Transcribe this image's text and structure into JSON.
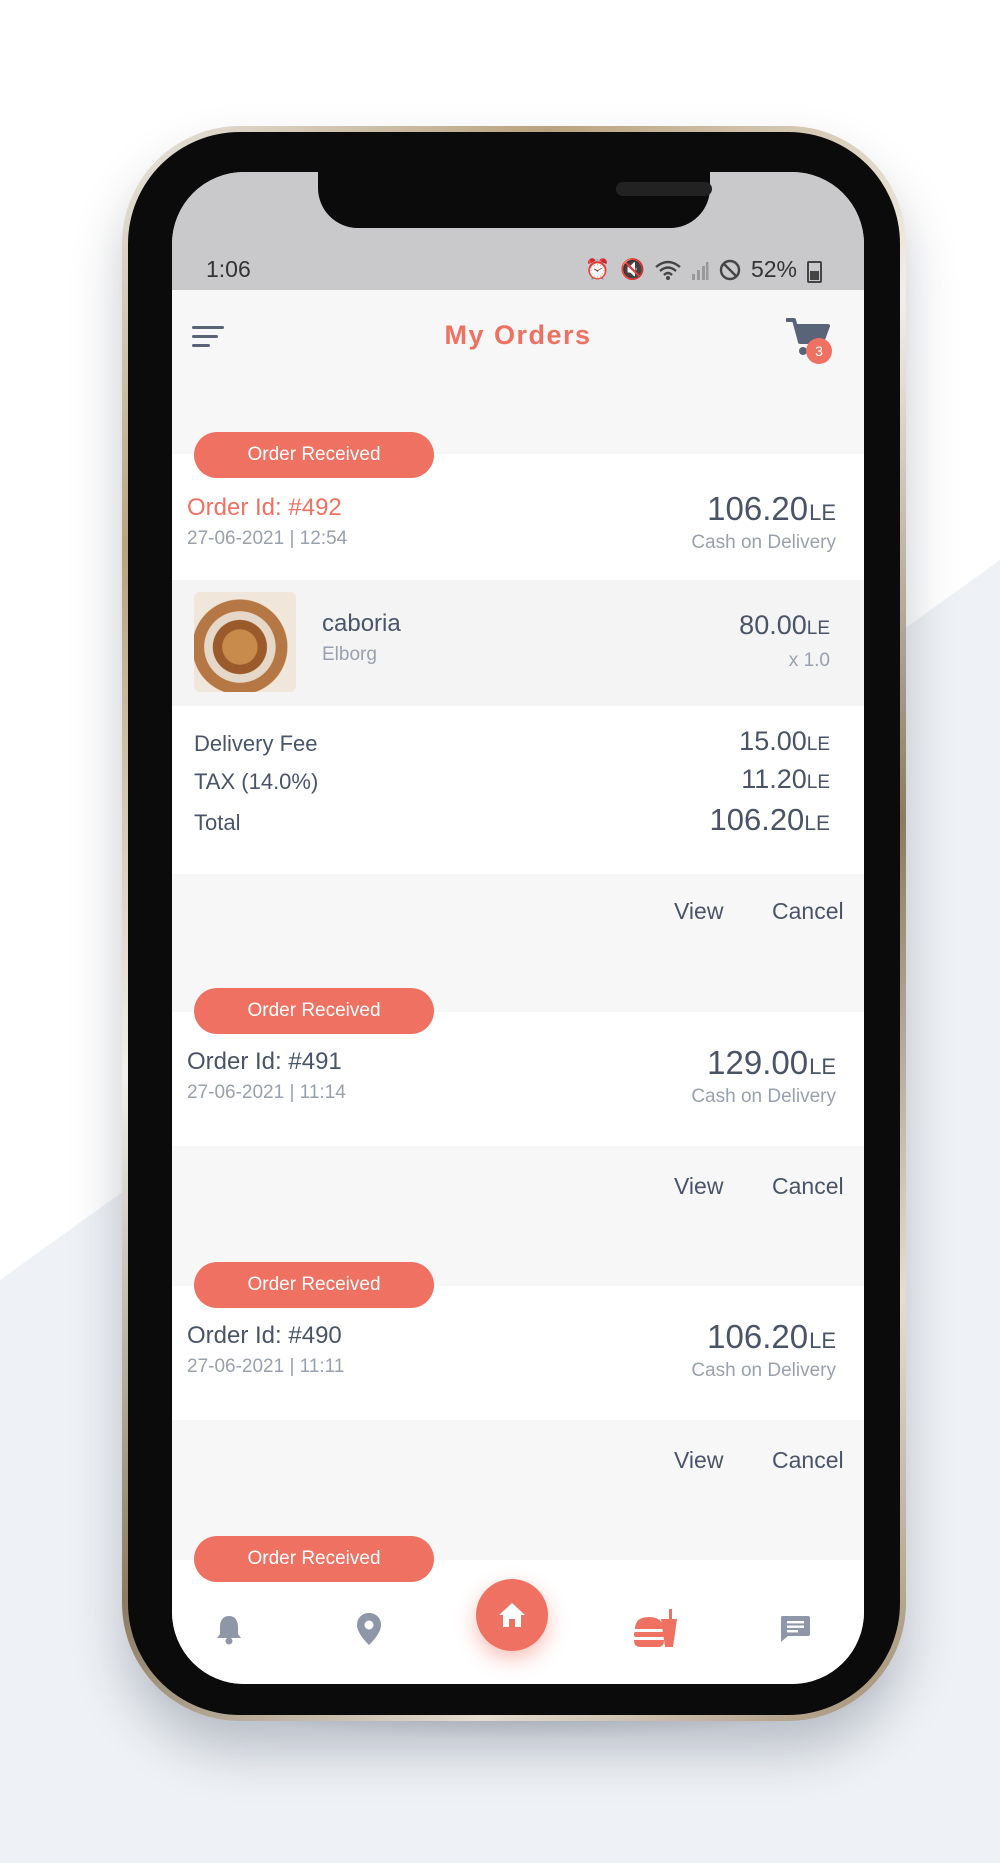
{
  "status_bar": {
    "time": "1:06",
    "battery": "52%"
  },
  "header": {
    "title": "My Orders",
    "cart_count": "3"
  },
  "currency": "LE",
  "orders": [
    {
      "status": "Order Received",
      "id": "Order Id: #492",
      "date": "27-06-2021 | 12:54",
      "amount": "106.20",
      "payment": "Cash on Delivery",
      "item": {
        "name": "caboria",
        "vendor": "Elborg",
        "price": "80.00",
        "qty": "x 1.0"
      },
      "fees": [
        {
          "label": "Delivery Fee",
          "value": "15.00"
        },
        {
          "label": "TAX (14.0%)",
          "value": "11.20"
        }
      ],
      "total_label": "Total",
      "total": "106.20",
      "view_label": "View",
      "cancel_label": "Cancel"
    },
    {
      "status": "Order Received",
      "id": "Order Id: #491",
      "date": "27-06-2021 | 11:14",
      "amount": "129.00",
      "payment": "Cash on Delivery",
      "view_label": "View",
      "cancel_label": "Cancel"
    },
    {
      "status": "Order Received",
      "id": "Order Id: #490",
      "date": "27-06-2021 | 11:11",
      "amount": "106.20",
      "payment": "Cash on Delivery",
      "view_label": "View",
      "cancel_label": "Cancel"
    },
    {
      "status": "Order Received"
    }
  ],
  "bottom_nav": {
    "items": [
      "bell-icon",
      "location-pin-icon",
      "home-icon",
      "food-order-icon",
      "chat-icon"
    ],
    "active": "food-order-icon"
  },
  "colors": {
    "accent": "#ef7161",
    "text": "#4a5469",
    "muted": "#9aa1ae"
  }
}
